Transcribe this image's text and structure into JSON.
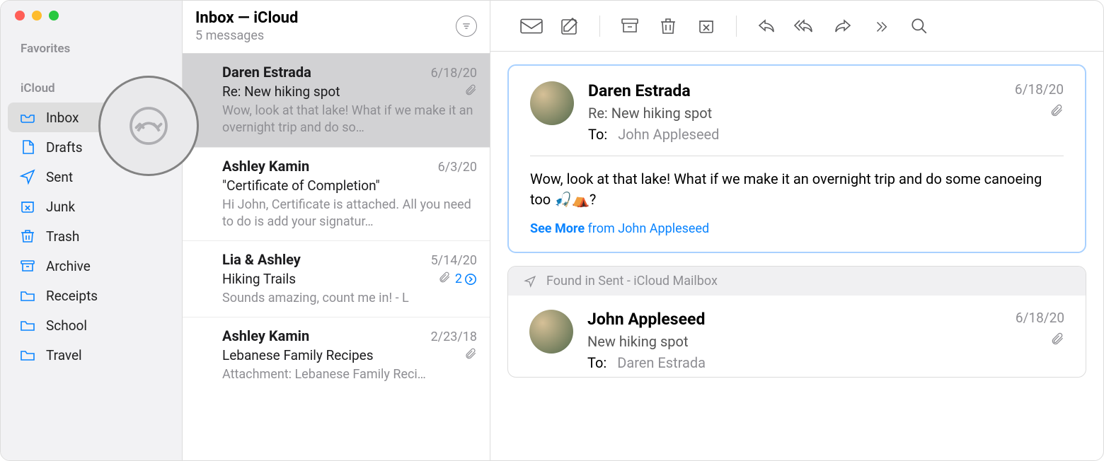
{
  "sidebar": {
    "favorites_label": "Favorites",
    "icloud_label": "iCloud",
    "items": [
      {
        "label": "Inbox",
        "icon": "inbox"
      },
      {
        "label": "Drafts",
        "icon": "drafts"
      },
      {
        "label": "Sent",
        "icon": "sent"
      },
      {
        "label": "Junk",
        "icon": "junk"
      },
      {
        "label": "Trash",
        "icon": "trash"
      },
      {
        "label": "Archive",
        "icon": "archive"
      },
      {
        "label": "Receipts",
        "icon": "folder"
      },
      {
        "label": "School",
        "icon": "folder"
      },
      {
        "label": "Travel",
        "icon": "folder"
      }
    ]
  },
  "msglist": {
    "title": "Inbox — iCloud",
    "subtitle": "5 messages",
    "messages": [
      {
        "sender": "Daren Estrada",
        "date": "6/18/20",
        "subject": "Re: New hiking spot",
        "preview": "Wow, look at that lake! What if we make it an overnight trip and do so…",
        "has_attachment": true,
        "selected": true
      },
      {
        "sender": "Ashley Kamin",
        "date": "6/3/20",
        "subject": "\"Certificate of Completion\"",
        "preview": "Hi John, Certificate is attached. All you need to do is add your signatur…",
        "has_attachment": false
      },
      {
        "sender": "Lia & Ashley",
        "date": "5/14/20",
        "subject": "Hiking Trails",
        "preview": "Sounds amazing, count me in! - L",
        "has_attachment": true,
        "thread_count": "2"
      },
      {
        "sender": "Ashley Kamin",
        "date": "2/23/18",
        "subject": "Lebanese Family Recipes",
        "preview": "Attachment: Lebanese Family Reci…",
        "has_attachment": true
      }
    ]
  },
  "detail": {
    "primary": {
      "from": "Daren Estrada",
      "subject": "Re: New hiking spot",
      "to_label": "To:",
      "to": "John Appleseed",
      "date": "6/18/20",
      "body": "Wow, look at that lake! What if we make it an overnight trip and do some canoeing too 🎣⛺?",
      "see_more": "See More",
      "see_more_rest": " from John Appleseed"
    },
    "found_label": "Found in Sent - iCloud Mailbox",
    "secondary": {
      "from": "John Appleseed",
      "subject": "New hiking spot",
      "to_label": "To:",
      "to": "Daren Estrada",
      "date": "6/18/20"
    }
  }
}
